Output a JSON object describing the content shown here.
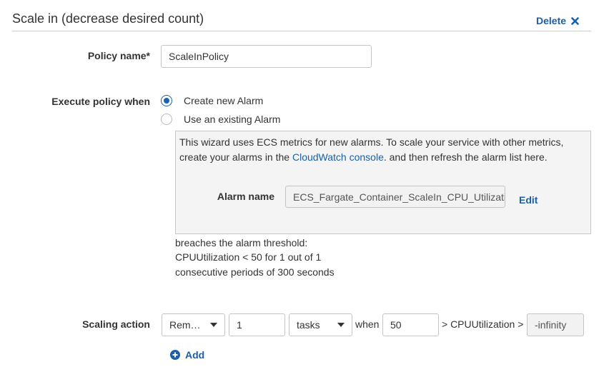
{
  "header": {
    "title": "Scale in (decrease desired count)",
    "delete_label": "Delete"
  },
  "policy_name": {
    "label": "Policy name*",
    "value": "ScaleInPolicy"
  },
  "execute": {
    "label": "Execute policy when",
    "options": [
      {
        "label": "Create new Alarm",
        "checked": true
      },
      {
        "label": "Use an existing Alarm",
        "checked": false
      }
    ]
  },
  "alarm_panel": {
    "info_line1": "This wizard uses ECS metrics for new alarms. To scale your service with other metrics,",
    "info_line2_pre": "create your alarms in the ",
    "info_link": "CloudWatch console",
    "info_line2_post": ". and then refresh the alarm list here.",
    "alarm_name_label": "Alarm name",
    "alarm_name_value": "ECS_Fargate_Container_ScaleIn_CPU_Utilization",
    "edit_label": "Edit"
  },
  "breach": {
    "line1": "breaches the alarm threshold:",
    "line2": "CPUUtilization < 50 for 1 out of 1",
    "line3": "consecutive periods of 300 seconds"
  },
  "scaling_action": {
    "label": "Scaling action",
    "action_select": "Rem…",
    "count_value": "1",
    "unit_select": "tasks",
    "when_label": "when",
    "threshold_value": "50",
    "metric_text": "> CPUUtilization >",
    "lower_bound": "-infinity"
  },
  "add_label": "Add",
  "colors": {
    "link": "#1a5fa8",
    "radio_selected": "#1a63b0",
    "panel_bg": "#f4f4f4"
  }
}
